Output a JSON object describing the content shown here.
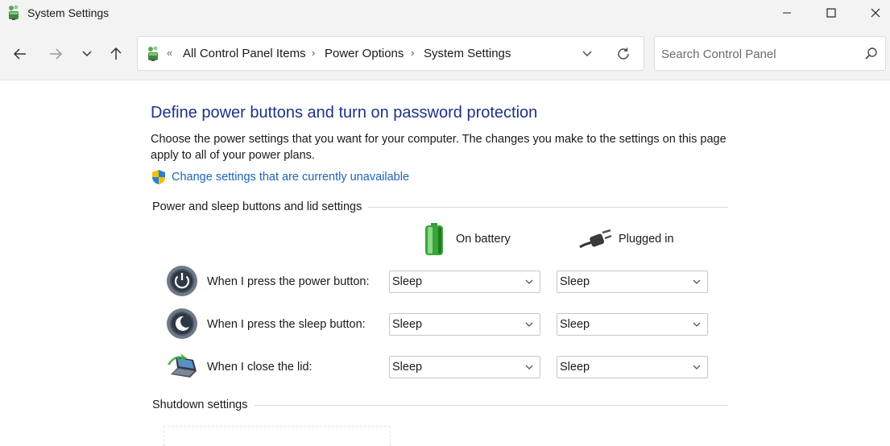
{
  "window": {
    "title": "System Settings"
  },
  "address": {
    "crumbs": [
      "All Control Panel Items",
      "Power Options",
      "System Settings"
    ]
  },
  "search": {
    "placeholder": "Search Control Panel"
  },
  "page": {
    "title": "Define power buttons and turn on password protection",
    "description": "Choose the power settings that you want for your computer. The changes you make to the settings on this page apply to all of your power plans.",
    "change_link": "Change settings that are currently unavailable"
  },
  "sections": {
    "buttons": "Power and sleep buttons and lid settings",
    "shutdown": "Shutdown settings"
  },
  "columns": {
    "battery": "On battery",
    "plugged": "Plugged in"
  },
  "rows": [
    {
      "label": "When I press the power button:",
      "battery": "Sleep",
      "plugged": "Sleep"
    },
    {
      "label": "When I press the sleep button:",
      "battery": "Sleep",
      "plugged": "Sleep"
    },
    {
      "label": "When I close the lid:",
      "battery": "Sleep",
      "plugged": "Sleep"
    }
  ],
  "colors": {
    "title_blue": "#1e3287",
    "link_blue": "#1f63b4",
    "chrome_bg": "#f3f3f3"
  },
  "icons": {
    "app": "control-panel-icon",
    "back": "arrow-left-icon",
    "forward": "arrow-right-icon",
    "recent": "chevron-down-icon",
    "up": "arrow-up-icon",
    "refresh": "refresh-icon",
    "search": "search-icon",
    "shield": "uac-shield-icon",
    "battery": "battery-icon",
    "plug": "power-plug-icon",
    "power": "power-button-icon",
    "sleep": "sleep-button-icon",
    "lid": "laptop-lid-icon"
  }
}
